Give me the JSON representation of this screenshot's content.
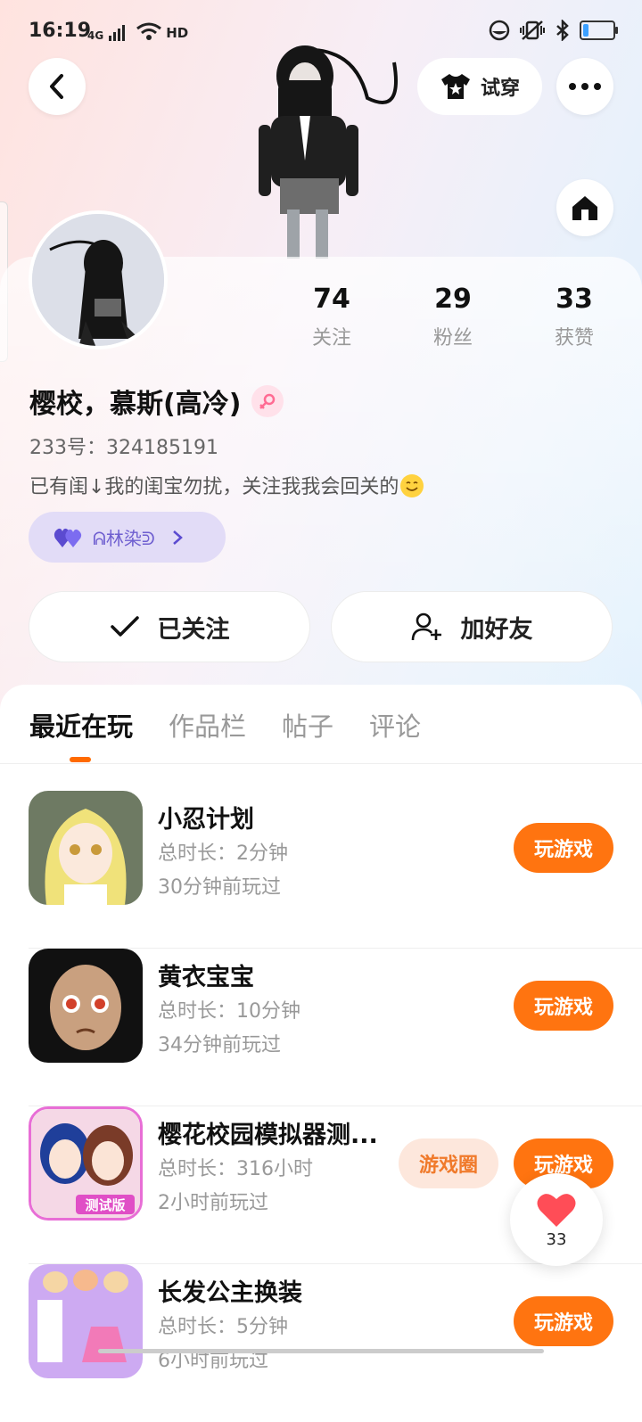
{
  "status_bar": {
    "time": "16:19",
    "network": "4G",
    "hd": "HD"
  },
  "header": {
    "tryon_label": "试穿"
  },
  "stats": [
    {
      "value": "74",
      "label": "关注"
    },
    {
      "value": "29",
      "label": "粉丝"
    },
    {
      "value": "33",
      "label": "获赞"
    }
  ],
  "profile": {
    "name": "樱校，慕斯(高冷)",
    "uid": "233号：324185191",
    "bio": "已有闺↓我的闺宝勿扰，关注我我会回关的",
    "tag_label": "ᕱ林染ᕲ"
  },
  "actions": {
    "following_label": "已关注",
    "add_friend_label": "加好友"
  },
  "tabs": [
    {
      "label": "最近在玩",
      "active": true
    },
    {
      "label": "作品栏",
      "active": false
    },
    {
      "label": "帖子",
      "active": false
    },
    {
      "label": "评论",
      "active": false
    }
  ],
  "games": [
    {
      "title": "小忍计划",
      "duration": "总时长：2分钟",
      "last_played": "30分钟前玩过",
      "play_label": "玩游戏"
    },
    {
      "title": "黄衣宝宝",
      "duration": "总时长：10分钟",
      "last_played": "34分钟前玩过",
      "play_label": "玩游戏"
    },
    {
      "title": "樱花校园模拟器测...",
      "duration": "总时长：316小时",
      "last_played": "2小时前玩过",
      "play_label": "玩游戏",
      "circle_label": "游戏圈",
      "icon_badge": "测试版"
    },
    {
      "title": "长发公主换装",
      "duration": "总时长：5分钟",
      "last_played": "6小时前玩过",
      "play_label": "玩游戏"
    }
  ],
  "floating_like": {
    "count": "33"
  },
  "colors": {
    "accent": "#ff7410",
    "tag_bg": "#e2dcf7",
    "tag_text": "#6f5fd0"
  }
}
